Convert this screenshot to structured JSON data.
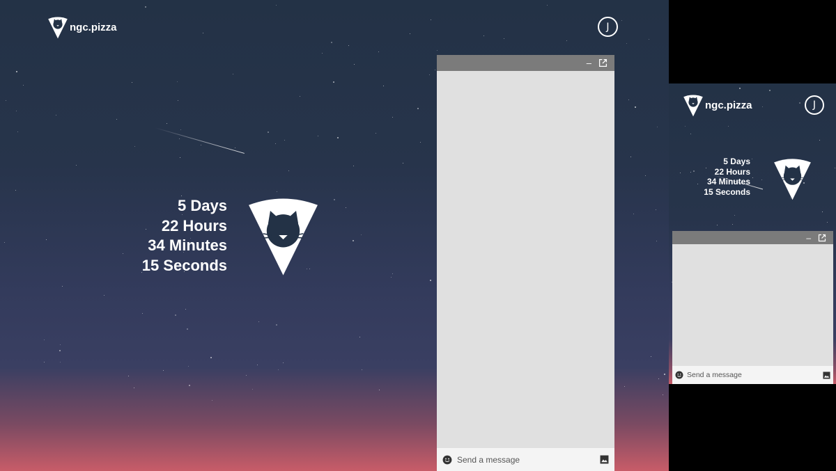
{
  "brand": {
    "name": "ngc.pizza",
    "logo_icon": "pizza-cat-icon"
  },
  "user": {
    "initial": "J"
  },
  "countdown": {
    "days": "5 Days",
    "hours": "22 Hours",
    "minutes": "34 Minutes",
    "seconds": "15 Seconds"
  },
  "chat": {
    "minimize_label": "–",
    "popout_icon": "open-in-new-icon",
    "placeholder": "Send a message",
    "emoji_icon": "smiley-icon",
    "image_icon": "image-icon"
  },
  "colors": {
    "chat_header": "#7b7b7b",
    "chat_body": "#e0e0e0",
    "chat_input": "#f4f4f4",
    "sky_top": "#233246",
    "sky_horizon": "#c85c68"
  }
}
